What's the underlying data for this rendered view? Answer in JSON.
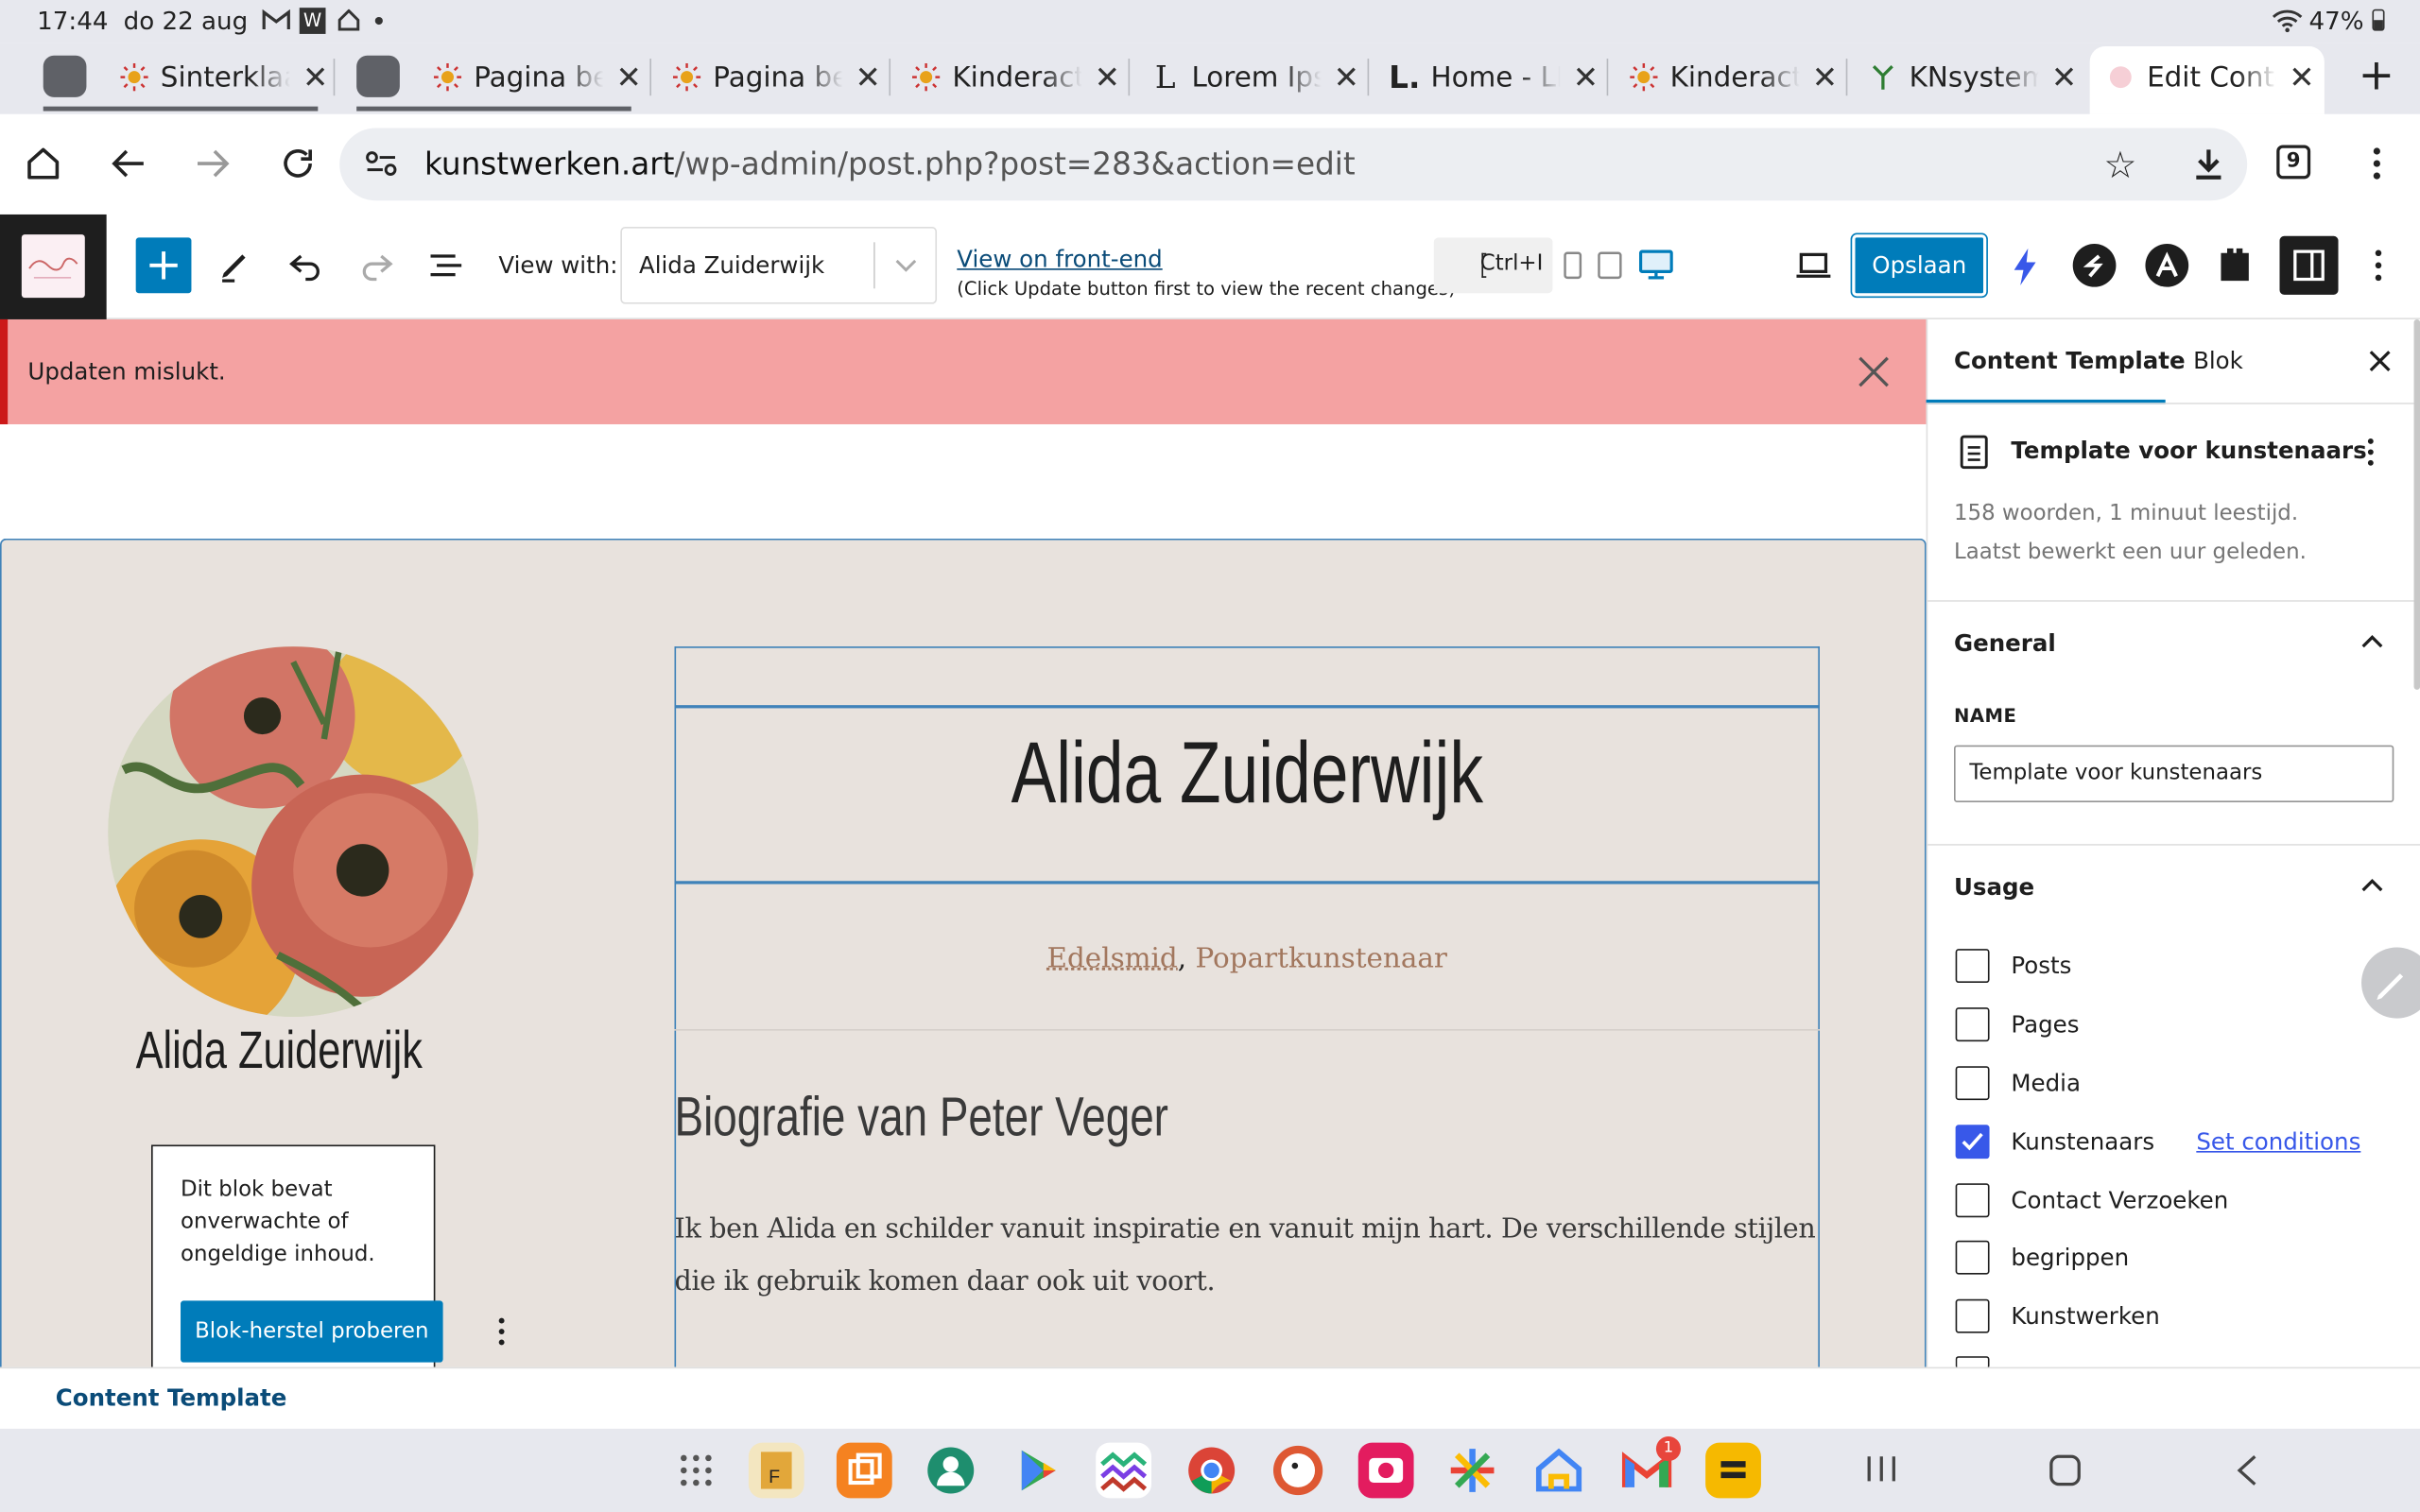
{
  "status": {
    "time": "17:44",
    "date": "do 22 aug",
    "battery": "47%"
  },
  "tabs": [
    {
      "title": "Sinterklaas",
      "icon": "sun-icon"
    },
    {
      "title": "Pagina bew",
      "icon": "sun-icon"
    },
    {
      "title": "Pagina bew",
      "icon": "sun-icon"
    },
    {
      "title": "Kinderacts",
      "icon": "sun-icon"
    },
    {
      "title": "Lorem Ipsu",
      "icon": "lorem-l-icon"
    },
    {
      "title": "Home - LIN",
      "icon": "l-logo-icon"
    },
    {
      "title": "Kinderacts",
      "icon": "sun-icon"
    },
    {
      "title": "KNsystem",
      "icon": "sprout-icon"
    },
    {
      "title": "Edit Conten",
      "icon": "edit-icon"
    }
  ],
  "browser": {
    "url_host": "kunstwerken.art",
    "url_path": "/wp-admin/post.php?post=283&action=edit",
    "tab_count": "9"
  },
  "toolbar": {
    "view_with_label": "View with:",
    "view_with_value": "Alida Zuiderwijk",
    "front_end_link": "View on front-end",
    "front_end_hint": "(Click Update button first to view the recent changes)",
    "shortcut": "Ctrl+I",
    "save_label": "Opslaan"
  },
  "notice": {
    "text": "Updaten mislukt."
  },
  "canvas": {
    "profile_name": "Alida Zuiderwijk",
    "invalid_block_text": "Dit blok bevat onverwachte of ongeldige inhoud.",
    "recover_button": "Blok-herstel proberen",
    "title": "Alida Zuiderwijk",
    "subtitle_1": "Edelsmid",
    "subtitle_sep": ",",
    "subtitle_2": "Popartkunstenaar",
    "bio_heading": "Biografie van Peter Veger",
    "bio_text": "Ik ben Alida en schilder vanuit inspiratie en vanuit mijn hart. De verschillende stijlen die ik gebruik komen daar ook uit voort."
  },
  "sidebar": {
    "tab_template": "Content Template",
    "tab_block": "Blok",
    "template_name": "Template voor kunstenaars",
    "meta_line_1": "158 woorden, 1 minuut leestijd.",
    "meta_line_2": "Laatst bewerkt een uur geleden.",
    "general_title": "General",
    "name_label": "NAME",
    "name_value": "Template voor kunstenaars",
    "usage_title": "Usage",
    "usage_items": [
      {
        "label": "Posts",
        "checked": false
      },
      {
        "label": "Pages",
        "checked": false
      },
      {
        "label": "Media",
        "checked": false
      },
      {
        "label": "Kunstenaars",
        "checked": true
      },
      {
        "label": "Contact Verzoeken",
        "checked": false
      },
      {
        "label": "begrippen",
        "checked": false
      },
      {
        "label": "Kunstwerken",
        "checked": false
      }
    ],
    "set_conditions": "Set conditions"
  },
  "footer": {
    "breadcrumb": "Content Template"
  },
  "colors": {
    "wp_blue": "#007cba",
    "notice_bg": "#f4a2a2",
    "notice_border": "#cc1818",
    "canvas_bg": "#e8e2dd",
    "checkbox_on": "#3858e9",
    "subtitle": "#a2775e"
  }
}
